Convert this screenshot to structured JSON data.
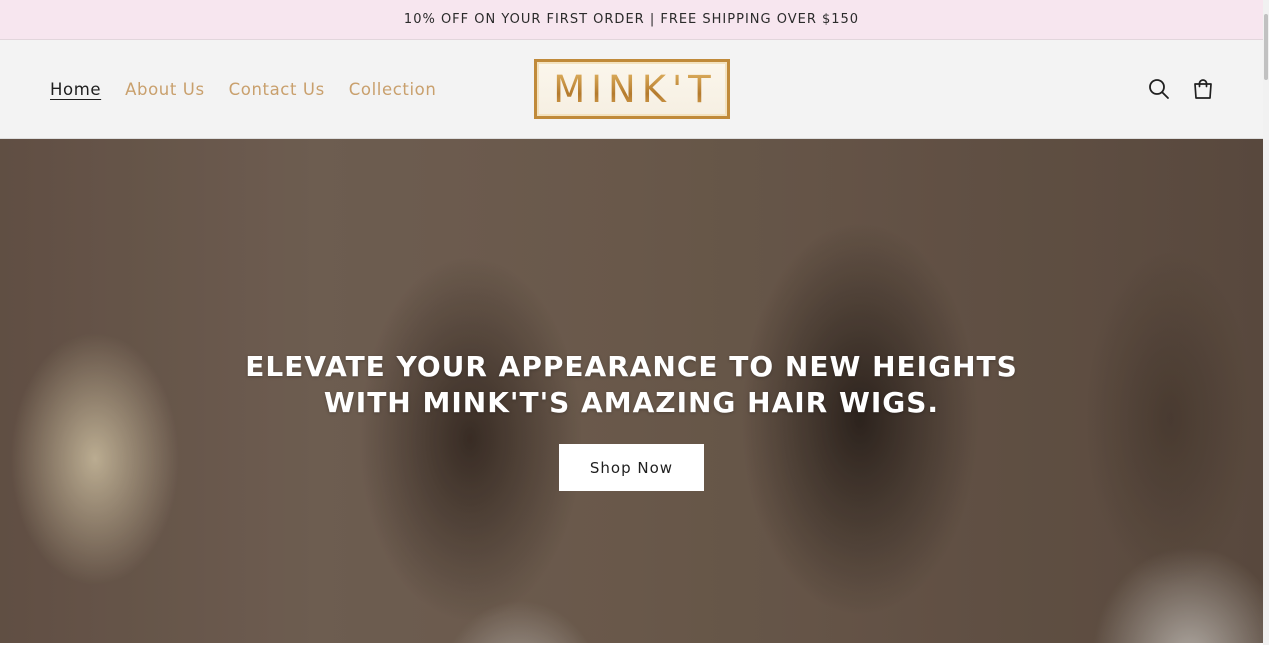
{
  "announcement": {
    "text": "10% OFF ON YOUR FIRST ORDER | FREE SHIPPING OVER $150"
  },
  "header": {
    "nav": [
      {
        "label": "Home",
        "active": true
      },
      {
        "label": "About Us",
        "active": false
      },
      {
        "label": "Contact Us",
        "active": false
      },
      {
        "label": "Collection",
        "active": false
      }
    ],
    "logo_text": "MINK'T",
    "icons": [
      "search-icon",
      "cart-icon"
    ]
  },
  "hero": {
    "heading": "ELEVATE YOUR APPEARANCE TO NEW HEIGHTS WITH MINK'T'S AMAZING HAIR WIGS.",
    "button_label": "Shop Now"
  },
  "colors": {
    "announcement_bg": "#f7e6ef",
    "header_bg": "#f3f3f3",
    "nav_link": "#c9a06d",
    "logo_gold": "#c08a3a"
  }
}
